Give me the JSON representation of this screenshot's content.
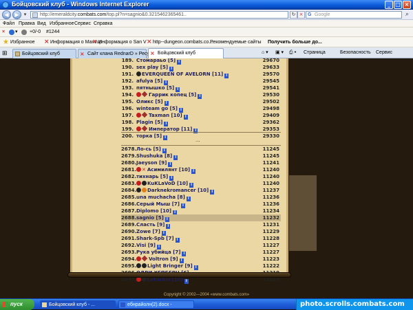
{
  "window": {
    "title": "Бойцовский клуб - Windows Internet Explorer"
  },
  "address": {
    "prefix": "http://emeraldcity.",
    "host": "combats.com",
    "suffix": "/top.pl?n=sagnio&0.3215462365461..",
    "search_placeholder": "Google"
  },
  "menu": [
    "Файл",
    "Правка",
    "Вид",
    "Избранное",
    "Сервис",
    "Справка"
  ],
  "toolbar": {
    "status": "+0/-0",
    "counter": "#1244"
  },
  "favorites": {
    "label": "Избранное",
    "items": [
      "Информация о Maxvup",
      "Информация о San V",
      "http--dungeon.combats.co...",
      "Рекомендуемые сайты",
      "Получить больше до..."
    ]
  },
  "tabs": [
    "Бойцовский клуб",
    "Сайт клана RednarD » Ресу...",
    "Бойцовский клуб"
  ],
  "commands": [
    "Страница",
    "Безопасность",
    "Сервис"
  ],
  "top_rows": [
    {
      "rank": "189.",
      "name": "Стомараьо [5]",
      "value": "29670",
      "icons": ""
    },
    {
      "rank": "190.",
      "name": "sex play [5]",
      "value": "29633",
      "icons": ""
    },
    {
      "rank": "191.",
      "name": "EVERQUEEN OF AVELORN [11]",
      "value": "29570",
      "icons": "dark"
    },
    {
      "rank": "192.",
      "name": "afulya [5]",
      "value": "29545",
      "icons": ""
    },
    {
      "rank": "193.",
      "name": "пятнышко [5]",
      "value": "29541",
      "icons": ""
    },
    {
      "rank": "194.",
      "name": "Гаррик копец [5]",
      "value": "29530",
      "icons": "red-gem"
    },
    {
      "rank": "195.",
      "name": "Оликс [5]",
      "value": "29502",
      "icons": ""
    },
    {
      "rank": "196.",
      "name": "winteam go [5]",
      "value": "29498",
      "icons": ""
    },
    {
      "rank": "197.",
      "name": "Taxman [10]",
      "value": "29409",
      "icons": "red-gem"
    },
    {
      "rank": "198.",
      "name": "Plagin [5]",
      "value": "29362",
      "icons": ""
    },
    {
      "rank": "199.",
      "name": "Император [11]",
      "value": "29353",
      "icons": "red-gem"
    },
    {
      "rank": "200.",
      "name": "торка [5]",
      "value": "29330",
      "icons": ""
    }
  ],
  "ellipsis": "...",
  "bottom_rows": [
    {
      "rank": "2678.",
      "name": "Ло-сь [5]",
      "value": "11245",
      "icons": ""
    },
    {
      "rank": "2679.",
      "name": "Shushuka [8]",
      "value": "11245",
      "icons": ""
    },
    {
      "rank": "2680.",
      "name": "Jaeyson [9]",
      "value": "11241",
      "icons": ""
    },
    {
      "rank": "2681.",
      "name": "Асимилянт [10]",
      "value": "11240",
      "icons": "red-x"
    },
    {
      "rank": "2682.",
      "name": "тихнарь [5]",
      "value": "11240",
      "icons": ""
    },
    {
      "rank": "2683.",
      "name": "KuKLaVoD [10]",
      "value": "11240",
      "icons": "red-dark"
    },
    {
      "rank": "2684.",
      "name": "Darknekromancer [10]",
      "value": "11237",
      "icons": "dark-orange"
    },
    {
      "rank": "2685.",
      "name": "una muchacha [8]",
      "value": "11236",
      "icons": ""
    },
    {
      "rank": "2686.",
      "name": "Серый Мыш [7]",
      "value": "11236",
      "icons": ""
    },
    {
      "rank": "2687.",
      "name": "Diplomo [10]",
      "value": "11234",
      "icons": ""
    },
    {
      "rank": "2688.",
      "name": "sagnio [5]",
      "value": "11232",
      "icons": "",
      "highlight": true
    },
    {
      "rank": "2689.",
      "name": "Сласть [9]",
      "value": "11231",
      "icons": ""
    },
    {
      "rank": "2690.",
      "name": "Zowe [7]",
      "value": "11229",
      "icons": ""
    },
    {
      "rank": "2691.",
      "name": "Shark-Spb [7]",
      "value": "11228",
      "icons": ""
    },
    {
      "rank": "2692.",
      "name": "Visi [9]",
      "value": "11227",
      "icons": ""
    },
    {
      "rank": "2693.",
      "name": "Рука убийца [7]",
      "value": "11227",
      "icons": ""
    },
    {
      "rank": "2694.",
      "name": "Voltron [9]",
      "value": "11223",
      "icons": "red-gem"
    },
    {
      "rank": "2695.",
      "name": "Light Bringer [9]",
      "value": "11222",
      "icons": "dark-dark"
    },
    {
      "rank": "2696.",
      "name": "ОДРИ ХЕПБЕРН [6]",
      "value": "11219",
      "icons": ""
    },
    {
      "rank": "2697.",
      "name": "Letuchis [10]",
      "value": "11219",
      "icons": "red-dark"
    }
  ],
  "footer": "Copyright © 2002—2004 «www.combats.com»",
  "taskbar": {
    "start": "пуск",
    "items": [
      "Бойцовский клуб - ...",
      "ебнрайолн(2).docx -"
    ],
    "watermark": "photo.scrolls.combats.com"
  }
}
